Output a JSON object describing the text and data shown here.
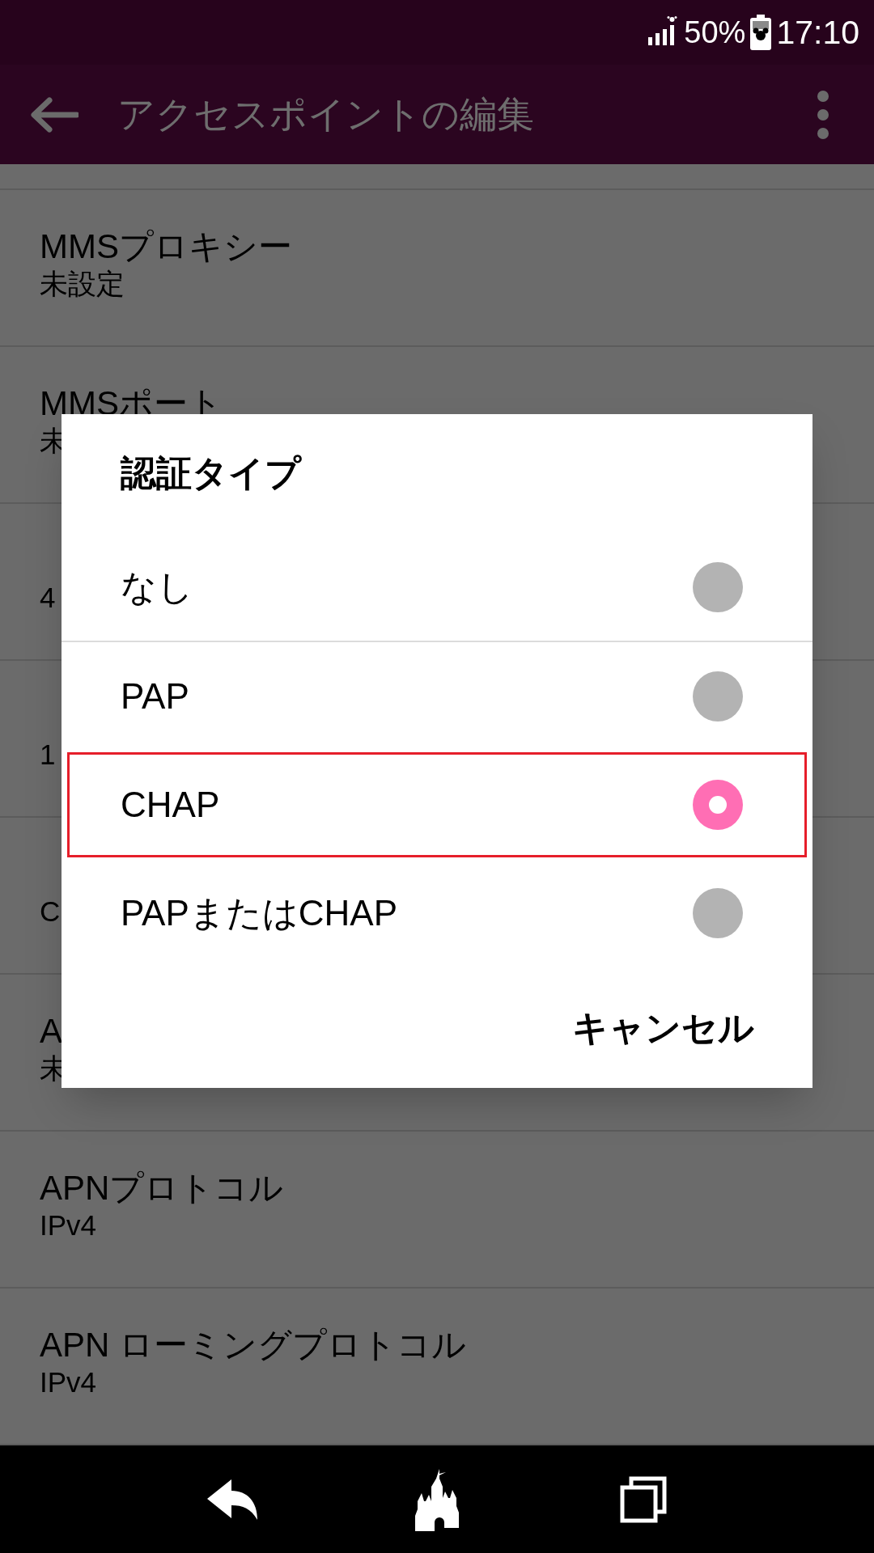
{
  "status_bar": {
    "battery": "50%",
    "time": "17:10"
  },
  "toolbar": {
    "title": "アクセスポイントの編集"
  },
  "settings": [
    {
      "title": "MMSプロキシー",
      "value": "未設定"
    },
    {
      "title": "MMSポート",
      "value": "未"
    },
    {
      "value": "4"
    },
    {
      "value": "1"
    },
    {
      "value": "C"
    },
    {
      "title": "A",
      "value": "未"
    },
    {
      "title": "APNプロトコル",
      "value": "IPv4"
    },
    {
      "title": "APN ローミングプロトコル",
      "value": "IPv4"
    }
  ],
  "dialog": {
    "title": "認証タイプ",
    "options": [
      {
        "label": "なし",
        "selected": false,
        "highlighted": false
      },
      {
        "label": "PAP",
        "selected": false,
        "highlighted": false
      },
      {
        "label": "CHAP",
        "selected": true,
        "highlighted": true
      },
      {
        "label": "PAPまたはCHAP",
        "selected": false,
        "highlighted": false
      }
    ],
    "cancel": "キャンセル"
  }
}
